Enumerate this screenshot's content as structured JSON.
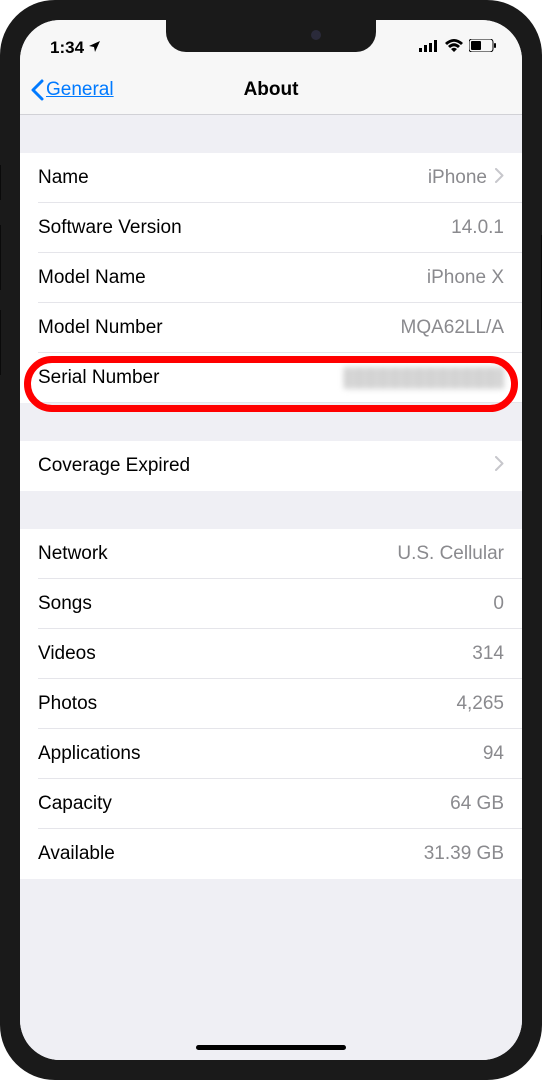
{
  "status": {
    "time": "1:34"
  },
  "nav": {
    "back_label": "General",
    "title": "About"
  },
  "group1": {
    "name_label": "Name",
    "name_value": "iPhone",
    "software_version_label": "Software Version",
    "software_version_value": "14.0.1",
    "model_name_label": "Model Name",
    "model_name_value": "iPhone X",
    "model_number_label": "Model Number",
    "model_number_value": "MQA62LL/A",
    "serial_number_label": "Serial Number"
  },
  "group2": {
    "coverage_label": "Coverage Expired"
  },
  "group3": {
    "network_label": "Network",
    "network_value": "U.S. Cellular",
    "songs_label": "Songs",
    "songs_value": "0",
    "videos_label": "Videos",
    "videos_value": "314",
    "photos_label": "Photos",
    "photos_value": "4,265",
    "applications_label": "Applications",
    "applications_value": "94",
    "capacity_label": "Capacity",
    "capacity_value": "64 GB",
    "available_label": "Available",
    "available_value": "31.39 GB"
  }
}
